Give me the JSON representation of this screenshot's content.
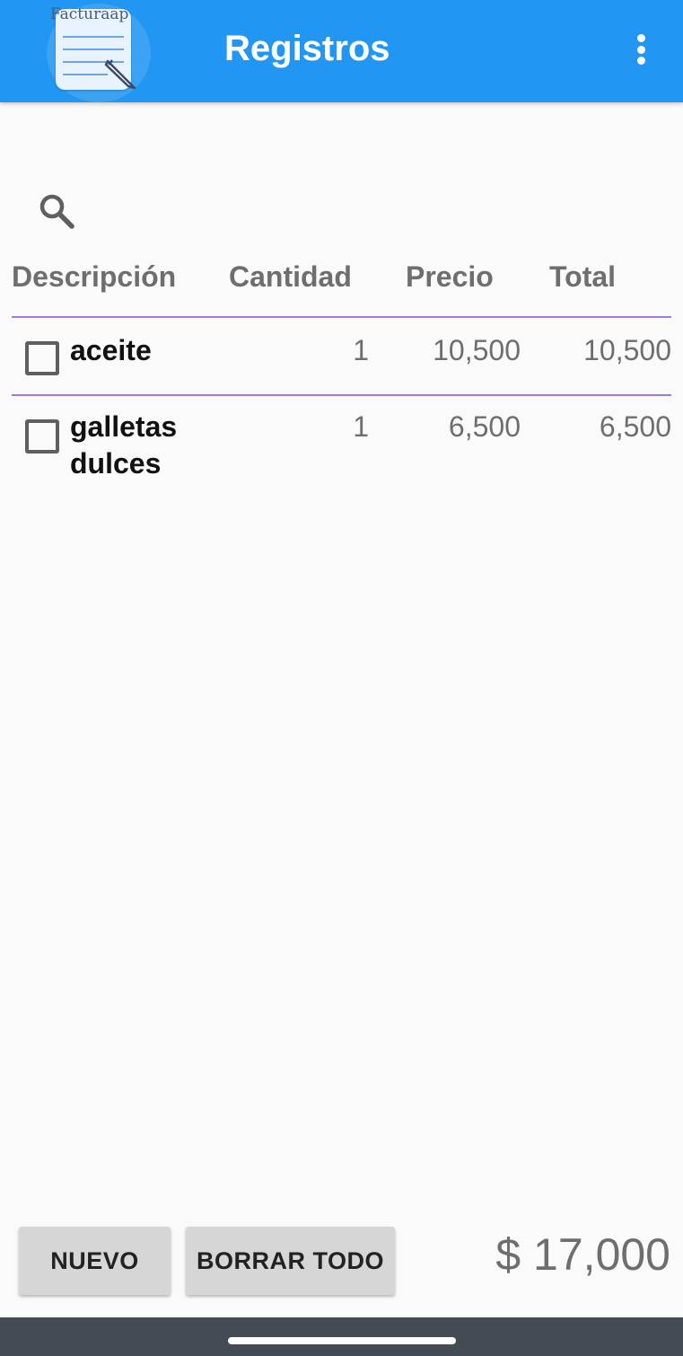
{
  "app": {
    "logo_text": "Facturaap",
    "title": "Registros"
  },
  "colors": {
    "appbar": "#2196f3",
    "divider": "#9c7ee0",
    "navbar": "#454b52"
  },
  "icons": {
    "search": "search-icon",
    "menu": "more-vert-icon"
  },
  "table": {
    "headers": {
      "description": "Descripción",
      "quantity": "Cantidad",
      "price": "Precio",
      "total": "Total"
    },
    "rows": [
      {
        "description": "aceite",
        "quantity": "1",
        "price": "10,500",
        "total": "10,500",
        "checked": false
      },
      {
        "description": "galletas dulces",
        "quantity": "1",
        "price": "6,500",
        "total": "6,500",
        "checked": false
      }
    ]
  },
  "footer": {
    "new_label": "NUEVO",
    "clear_label": "BORRAR TODO",
    "grand_total": "$ 17,000"
  }
}
